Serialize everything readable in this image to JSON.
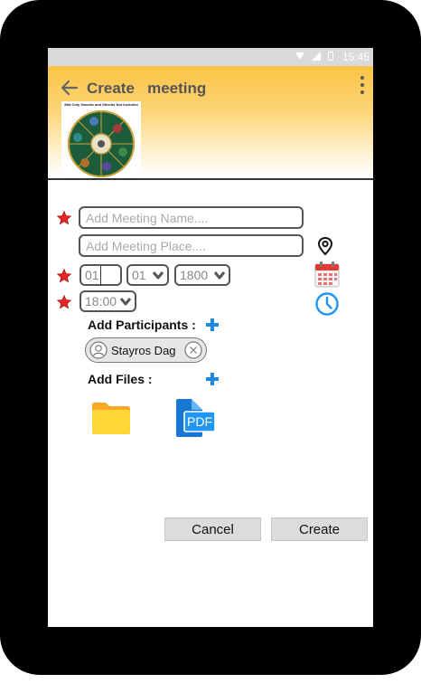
{
  "status_bar": {
    "time": "15:45"
  },
  "header": {
    "title": "Create   meeting",
    "thumbnail_caption": "Mat Only Swords and Shields Not Included"
  },
  "form": {
    "meeting_name_placeholder": "Add Meeting Name....",
    "meeting_place_placeholder": "Add Meeting Place....",
    "day_value": "01",
    "month_value": "01",
    "year_value": "1800",
    "time_value": "18:00"
  },
  "participants": {
    "label": "Add Participants :",
    "chip_name": "Stayros Dag"
  },
  "files": {
    "label": "Add Files :",
    "pdf_label": "PDF"
  },
  "actions": {
    "cancel_label": "Cancel",
    "create_label": "Create"
  },
  "colors": {
    "header_top": "#fbc343",
    "accent_blue": "#1e88e5",
    "star_red": "#e52424",
    "folder": "#fbc02d"
  },
  "icons": [
    "back-arrow-icon",
    "more-vert-icon",
    "star-icon",
    "location-pin-icon",
    "calendar-icon",
    "clock-icon",
    "plus-icon",
    "person-icon",
    "close-icon",
    "folder-icon",
    "pdf-file-icon",
    "chevron-down-icon"
  ]
}
